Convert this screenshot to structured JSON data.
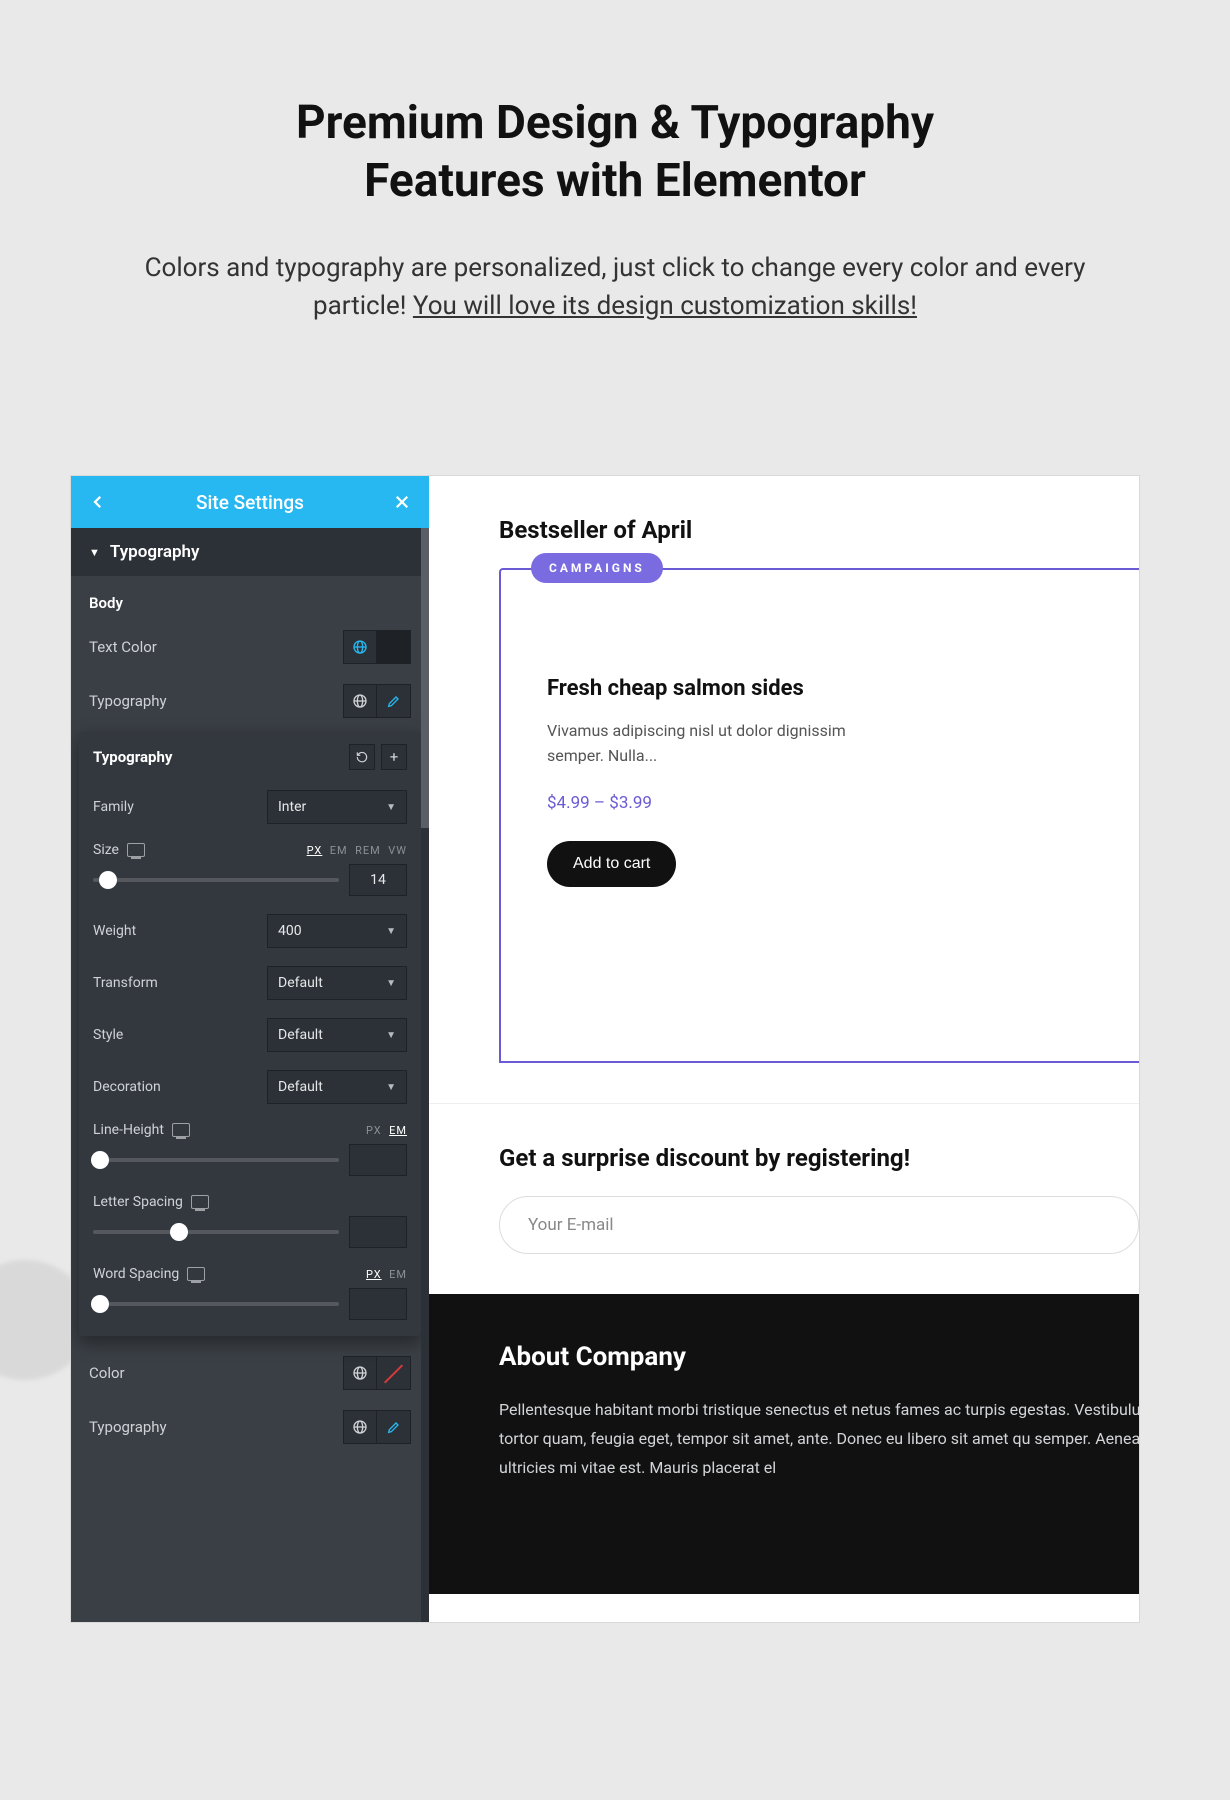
{
  "hero": {
    "line1": "Premium Design & Typography",
    "line2": "Features with Elementor",
    "sub_plain": "Colors and typography are personalized, just click to change every color and every particle! ",
    "sub_underlined": "You will love its design customization skills!"
  },
  "panel": {
    "title": "Site Settings",
    "section": "Typography",
    "body_label": "Body",
    "rows": {
      "text_color": "Text Color",
      "typography": "Typography",
      "color": "Color",
      "typography2": "Typography"
    },
    "popover": {
      "title": "Typography",
      "family_label": "Family",
      "family_value": "Inter",
      "size_label": "Size",
      "size_units": [
        "PX",
        "EM",
        "REM",
        "VW"
      ],
      "size_active_unit": "PX",
      "size_value": "14",
      "weight_label": "Weight",
      "weight_value": "400",
      "transform_label": "Transform",
      "transform_value": "Default",
      "style_label": "Style",
      "style_value": "Default",
      "decoration_label": "Decoration",
      "decoration_value": "Default",
      "lineheight_label": "Line-Height",
      "lineheight_units": [
        "PX",
        "EM"
      ],
      "lineheight_active_unit": "EM",
      "letterspacing_label": "Letter Spacing",
      "wordspacing_label": "Word Spacing",
      "wordspacing_units": [
        "PX",
        "EM"
      ],
      "wordspacing_active_unit": "PX"
    }
  },
  "preview": {
    "bestseller_title": "Bestseller of April",
    "badge": "CAMPAIGNS",
    "product_title": "Fresh cheap salmon sides",
    "product_desc": "Vivamus adipiscing nisl ut dolor dignissim semper. Nulla...",
    "price": "$4.99 – $3.99",
    "add_to_cart": "Add to cart",
    "discount_title": "Get a surprise discount by registering!",
    "email_placeholder": "Your E-mail",
    "about_title": "About Company",
    "about_body": "Pellentesque habitant morbi tristique senectus et netus fames ac turpis egestas. Vestibulum tortor quam, feugia eget, tempor sit amet, ante. Donec eu libero sit amet qu semper. Aenean ultricies mi vitae est. Mauris placerat el"
  }
}
